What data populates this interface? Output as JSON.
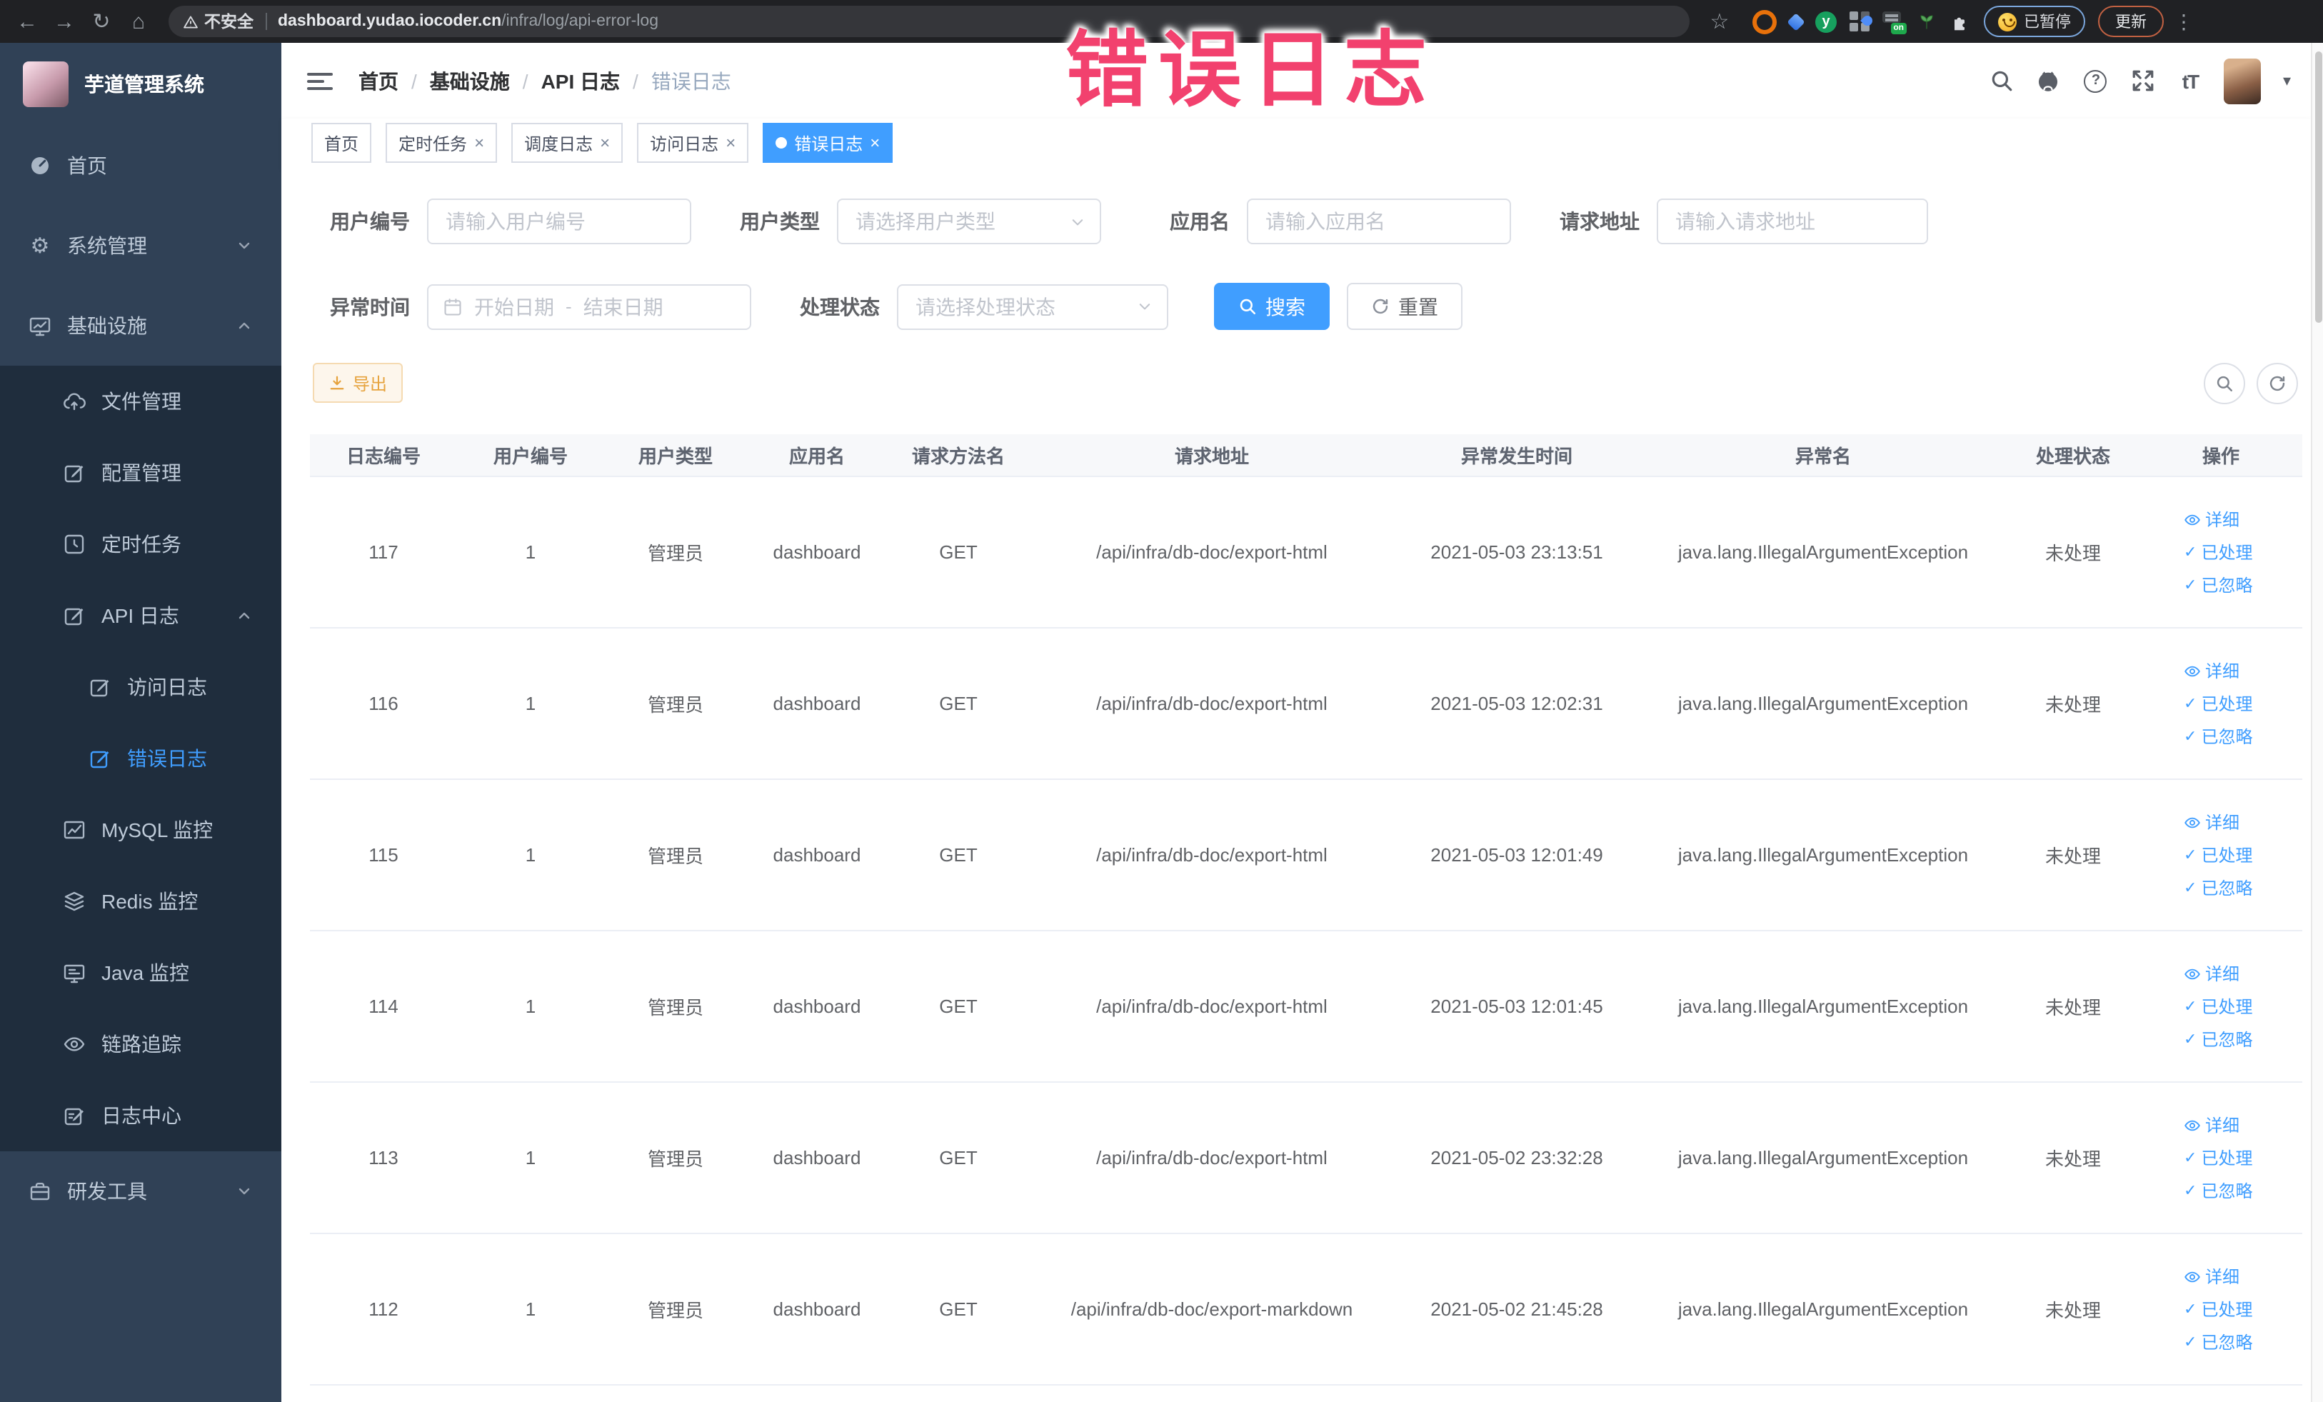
{
  "browser": {
    "security_label": "不安全",
    "url_domain": "dashboard.yudao.iocoder.cn",
    "url_path": "/infra/log/api-error-log",
    "paused_label": "已暂停",
    "update_label": "更新"
  },
  "annotation": {
    "text": "错误日志",
    "color": "#f2416e"
  },
  "sidebar": {
    "app_title": "芋道管理系统",
    "items": [
      {
        "label": "首页",
        "icon": "dashboard-icon"
      },
      {
        "label": "系统管理",
        "icon": "gear-icon",
        "chevron": "down"
      },
      {
        "label": "基础设施",
        "icon": "monitor-icon",
        "chevron": "up"
      },
      {
        "label": "文件管理",
        "icon": "cloud-upload-icon"
      },
      {
        "label": "配置管理",
        "icon": "edit-icon"
      },
      {
        "label": "定时任务",
        "icon": "timer-icon"
      },
      {
        "label": "API 日志",
        "icon": "log-icon",
        "chevron": "up"
      },
      {
        "label": "访问日志",
        "icon": "log-icon"
      },
      {
        "label": "错误日志",
        "icon": "log-icon",
        "active": true
      },
      {
        "label": "MySQL 监控",
        "icon": "chart-icon"
      },
      {
        "label": "Redis 监控",
        "icon": "layers-icon"
      },
      {
        "label": "Java 监控",
        "icon": "java-monitor-icon"
      },
      {
        "label": "链路追踪",
        "icon": "eye-icon"
      },
      {
        "label": "日志中心",
        "icon": "log-center-icon"
      },
      {
        "label": "研发工具",
        "icon": "toolbox-icon",
        "chevron": "down"
      }
    ]
  },
  "header": {
    "breadcrumb": [
      "首页",
      "基础设施",
      "API 日志",
      "错误日志"
    ]
  },
  "tabs": {
    "items": [
      {
        "label": "首页",
        "closable": false,
        "active": false
      },
      {
        "label": "定时任务",
        "closable": true,
        "active": false
      },
      {
        "label": "调度日志",
        "closable": true,
        "active": false
      },
      {
        "label": "访问日志",
        "closable": true,
        "active": false
      },
      {
        "label": "错误日志",
        "closable": true,
        "active": true
      }
    ]
  },
  "filters": {
    "user_id": {
      "label": "用户编号",
      "placeholder": "请输入用户编号"
    },
    "user_type": {
      "label": "用户类型",
      "placeholder": "请选择用户类型"
    },
    "app_name": {
      "label": "应用名",
      "placeholder": "请输入应用名"
    },
    "request_url": {
      "label": "请求地址",
      "placeholder": "请输入请求地址"
    },
    "exception_time": {
      "label": "异常时间",
      "start_placeholder": "开始日期",
      "separator": "-",
      "end_placeholder": "结束日期"
    },
    "process_status": {
      "label": "处理状态",
      "placeholder": "请选择处理状态"
    },
    "search_button": "搜索",
    "reset_button": "重置"
  },
  "toolbar": {
    "export_button": "导出"
  },
  "table": {
    "columns": [
      "日志编号",
      "用户编号",
      "用户类型",
      "应用名",
      "请求方法名",
      "请求地址",
      "异常发生时间",
      "异常名",
      "处理状态",
      "操作"
    ],
    "actions": {
      "detail": "详细",
      "processed": "已处理",
      "ignored": "已忽略"
    },
    "rows": [
      {
        "id": "117",
        "user_id": "1",
        "user_type": "管理员",
        "app": "dashboard",
        "method": "GET",
        "url": "/api/infra/db-doc/export-html",
        "time": "2021-05-03 23:13:51",
        "exception": "java.lang.IllegalArgumentException",
        "status": "未处理"
      },
      {
        "id": "116",
        "user_id": "1",
        "user_type": "管理员",
        "app": "dashboard",
        "method": "GET",
        "url": "/api/infra/db-doc/export-html",
        "time": "2021-05-03 12:02:31",
        "exception": "java.lang.IllegalArgumentException",
        "status": "未处理"
      },
      {
        "id": "115",
        "user_id": "1",
        "user_type": "管理员",
        "app": "dashboard",
        "method": "GET",
        "url": "/api/infra/db-doc/export-html",
        "time": "2021-05-03 12:01:49",
        "exception": "java.lang.IllegalArgumentException",
        "status": "未处理"
      },
      {
        "id": "114",
        "user_id": "1",
        "user_type": "管理员",
        "app": "dashboard",
        "method": "GET",
        "url": "/api/infra/db-doc/export-html",
        "time": "2021-05-03 12:01:45",
        "exception": "java.lang.IllegalArgumentException",
        "status": "未处理"
      },
      {
        "id": "113",
        "user_id": "1",
        "user_type": "管理员",
        "app": "dashboard",
        "method": "GET",
        "url": "/api/infra/db-doc/export-html",
        "time": "2021-05-02 23:32:28",
        "exception": "java.lang.IllegalArgumentException",
        "status": "未处理"
      },
      {
        "id": "112",
        "user_id": "1",
        "user_type": "管理员",
        "app": "dashboard",
        "method": "GET",
        "url": "/api/infra/db-doc/export-markdown",
        "time": "2021-05-02 21:45:28",
        "exception": "java.lang.IllegalArgumentException",
        "status": "未处理"
      }
    ]
  },
  "colors": {
    "primary": "#409eff",
    "sidebar_bg": "#304156",
    "sidebar_submenu_bg": "#1f2d3d",
    "warning": "#e6a23c",
    "annotation_pink": "#f2416e",
    "tab_active": "#409eff"
  }
}
